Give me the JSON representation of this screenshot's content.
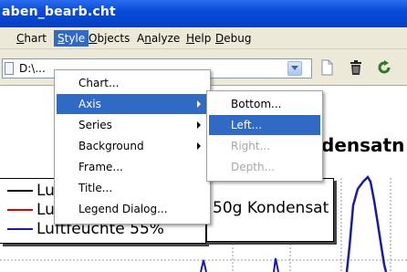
{
  "window": {
    "title": "aben_bearb.cht"
  },
  "menubar": {
    "items": [
      {
        "label": "Chart",
        "underline": "C"
      },
      {
        "label": "Style",
        "underline": "S",
        "active": true
      },
      {
        "label": "Objects",
        "underline": "O"
      },
      {
        "label": "Analyze",
        "underline": "n"
      },
      {
        "label": "Help",
        "underline": "H"
      },
      {
        "label": "Debug",
        "underline": "D"
      }
    ]
  },
  "toolbar": {
    "path_value": "D:\\...",
    "icons": [
      "new-document-icon",
      "trash-icon",
      "refresh-icon"
    ]
  },
  "style_menu": {
    "items": [
      {
        "label": "Chart...",
        "submenu": false
      },
      {
        "label": "Axis",
        "submenu": true,
        "highlighted": true
      },
      {
        "label": "Series",
        "submenu": true
      },
      {
        "label": "Background",
        "submenu": true
      },
      {
        "label": "Frame...",
        "submenu": false
      },
      {
        "label": "Title...",
        "submenu": false
      },
      {
        "label": "Legend Dialog...",
        "submenu": false
      }
    ]
  },
  "axis_submenu": {
    "items": [
      {
        "label": "Bottom...",
        "enabled": true
      },
      {
        "label": "Left...",
        "enabled": true,
        "highlighted": true
      },
      {
        "label": "Right...",
        "enabled": false
      },
      {
        "label": "Depth...",
        "enabled": false
      }
    ]
  },
  "chart": {
    "title_fragment": "densatn",
    "legend": [
      {
        "text": "Lu",
        "color": "#000000"
      },
      {
        "text": "Lu",
        "color": "#e00000"
      },
      {
        "text": "Luftfeuchte 55%",
        "color": "#1a1aa8"
      }
    ],
    "legend_extension_text": "50g Kondensat"
  },
  "colors": {
    "titlebar": "#0a4ad8",
    "menu_highlight": "#316ac5",
    "series_blue": "#1a1aa8"
  }
}
